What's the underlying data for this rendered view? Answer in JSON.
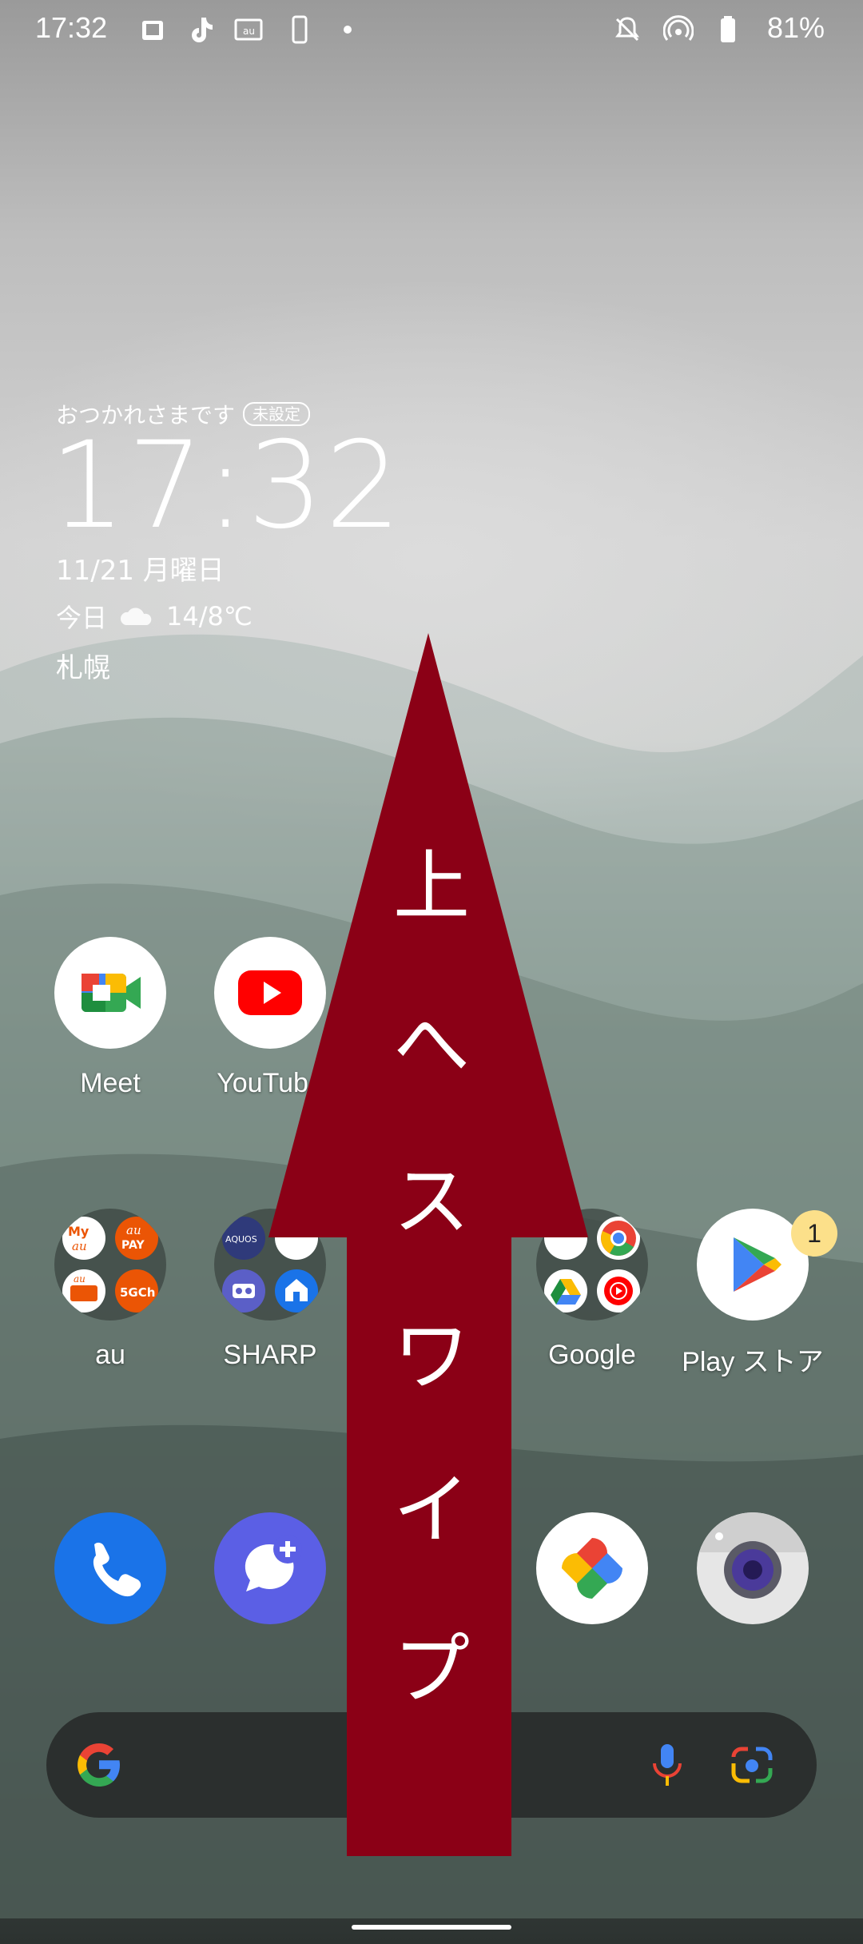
{
  "status_bar": {
    "time": "17:32",
    "battery": "81%"
  },
  "widget": {
    "greeting": "おつかれさまです",
    "badge": "未設定",
    "clock": "17:32",
    "date": "11/21 月曜日",
    "weather_label": "今日",
    "temperature": "14/8℃",
    "city": "札幌"
  },
  "apps": {
    "row1": [
      {
        "label": "Meet"
      },
      {
        "label": "YouTube"
      }
    ],
    "row2": [
      {
        "label": "au"
      },
      {
        "label": "SHARP"
      },
      {
        "label": "Google"
      },
      {
        "label": "Play ストア",
        "badge": "1"
      }
    ]
  },
  "overlay": {
    "instruction": [
      "上",
      "へ",
      "ス",
      "ワ",
      "イ",
      "プ"
    ],
    "color": "#8b0016"
  },
  "colors": {
    "search_bg": "#2b2f2e",
    "google_blue": "#4285f4",
    "google_red": "#ea4335",
    "google_yellow": "#fbbc04",
    "google_green": "#34a853"
  }
}
